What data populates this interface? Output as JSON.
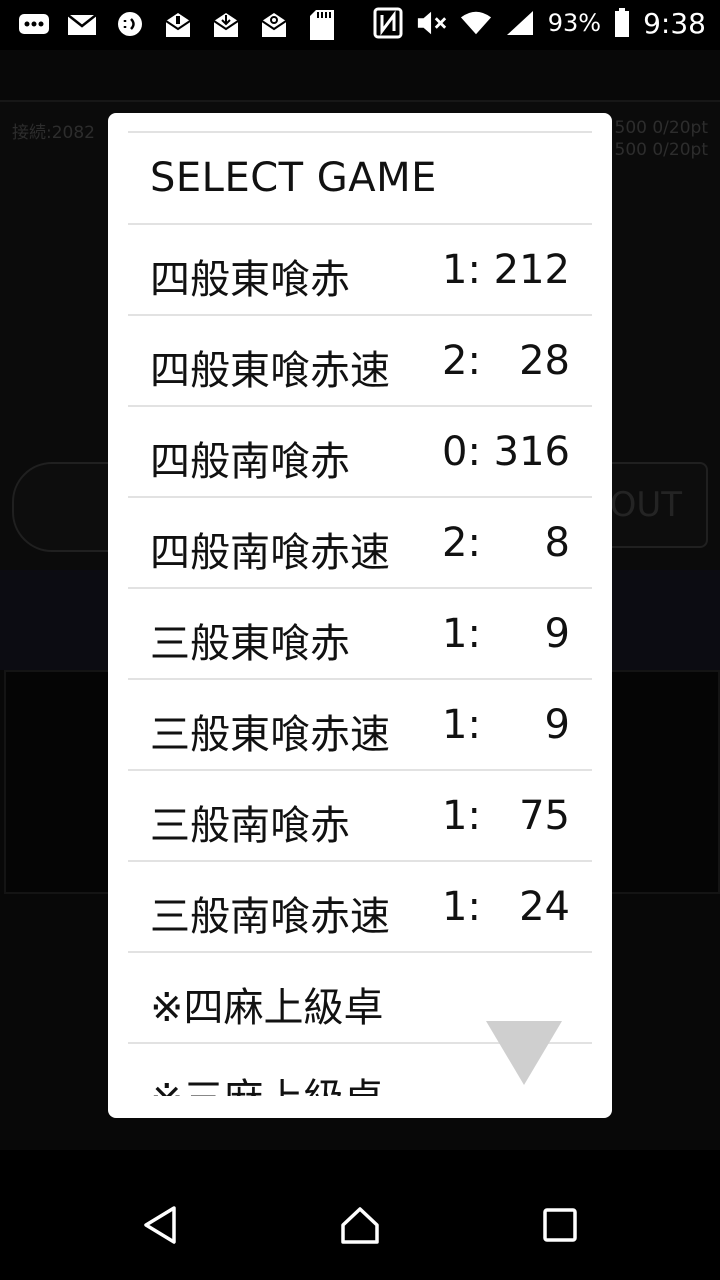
{
  "status_bar": {
    "battery": "93%",
    "time": "9:38"
  },
  "background": {
    "connection": "接続:2082",
    "score_line_1": "500 0/20pt",
    "score_line_2": "500 0/20pt",
    "logout_label": "OUT"
  },
  "dialog": {
    "title": "SELECT GAME",
    "items": [
      {
        "name": "四般東喰赤",
        "count": "1: 212"
      },
      {
        "name": "四般東喰赤速",
        "count": "2:   28"
      },
      {
        "name": "四般南喰赤",
        "count": "0: 316"
      },
      {
        "name": "四般南喰赤速",
        "count": "2:     8"
      },
      {
        "name": "三般東喰赤",
        "count": "1:     9"
      },
      {
        "name": "三般東喰赤速",
        "count": "1:     9"
      },
      {
        "name": "三般南喰赤",
        "count": "1:   75"
      },
      {
        "name": "三般南喰赤速",
        "count": "1:   24"
      },
      {
        "name": "※四麻上級卓",
        "count": ""
      },
      {
        "name": "※三麻上級卓",
        "count": ""
      }
    ]
  },
  "icons": {
    "status_left": [
      "messages-icon",
      "mail-icon",
      "chat-icon",
      "mail-alert-icon",
      "mail-download-icon",
      "mail-sync-icon",
      "sd-card-icon"
    ],
    "status_right": [
      "nfc-icon",
      "mute-icon",
      "wifi-icon",
      "signal-icon",
      "battery-icon"
    ],
    "nav": [
      "back-icon",
      "home-icon",
      "recents-icon"
    ]
  }
}
